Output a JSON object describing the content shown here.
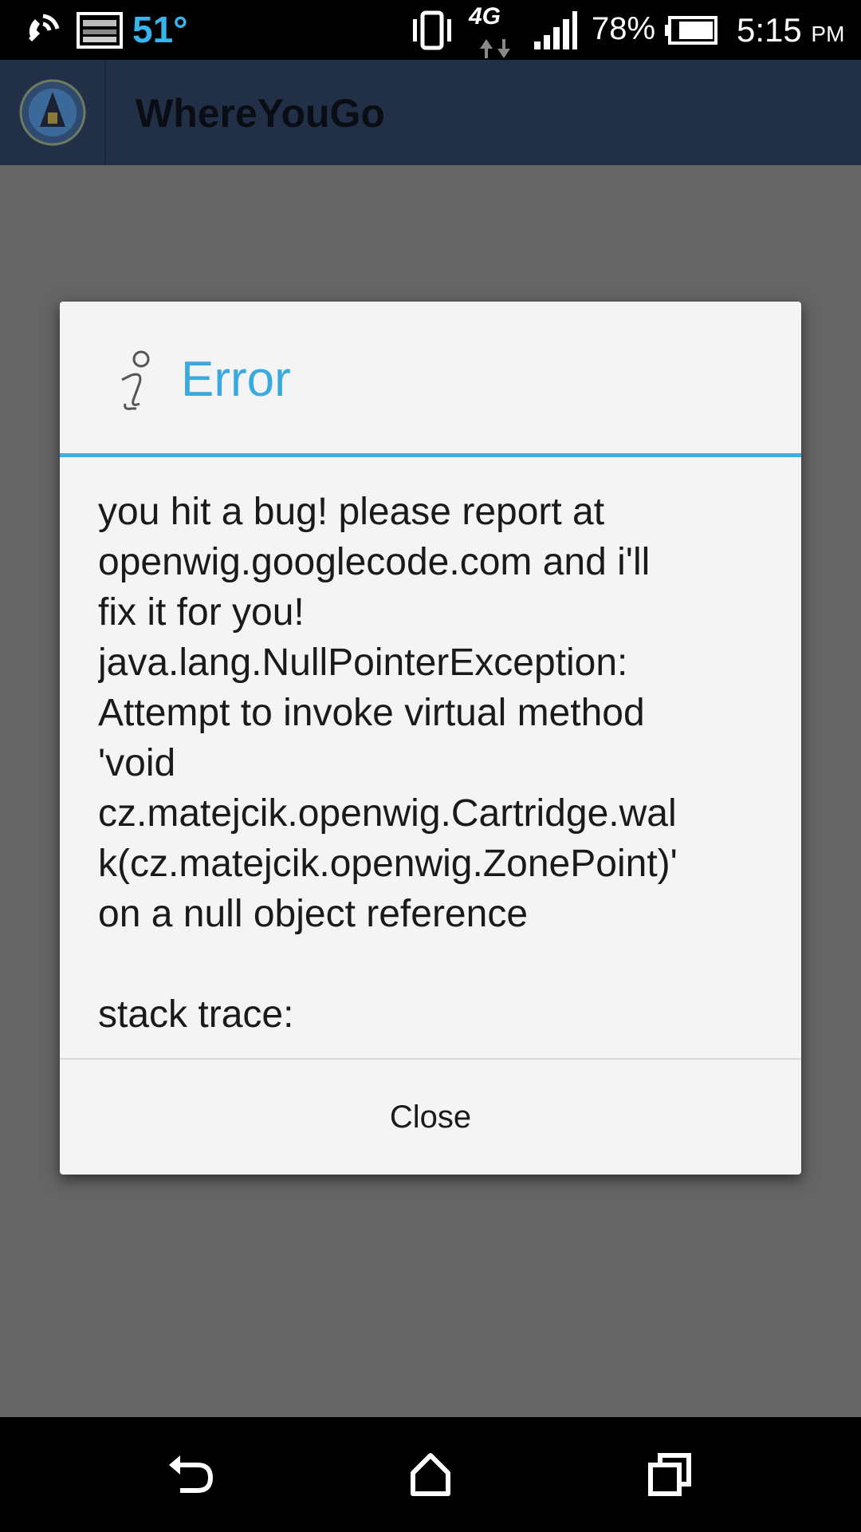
{
  "status_bar": {
    "temperature": "51°",
    "network_type": "4G",
    "battery_percent": "78%",
    "time": "5:15",
    "ampm": "PM",
    "icons": [
      "wifi-calling-icon",
      "weather-icon",
      "vibrate-icon",
      "data-arrows-icon",
      "signal-icon",
      "battery-icon"
    ]
  },
  "action_bar": {
    "title": "WhereYouGo"
  },
  "dialog": {
    "title": "Error",
    "icon": "info-icon",
    "message_lines": [
      "you hit a bug! please report at",
      "openwig.googlecode.com and i'll",
      "fix it for you!",
      "java.lang.NullPointerException:",
      "Attempt to invoke virtual method",
      "'void",
      "cz.matejcik.openwig.Cartridge.wal",
      "k(cz.matejcik.openwig.ZonePoint)'",
      "on a null object reference",
      "",
      "stack trace:"
    ],
    "button_label": "Close"
  },
  "nav_bar": {
    "buttons": [
      "back-icon",
      "home-icon",
      "recents-icon"
    ]
  },
  "colors": {
    "accent": "#3aa9dd",
    "action_bar": "#223047",
    "dim_background": "#656565"
  }
}
